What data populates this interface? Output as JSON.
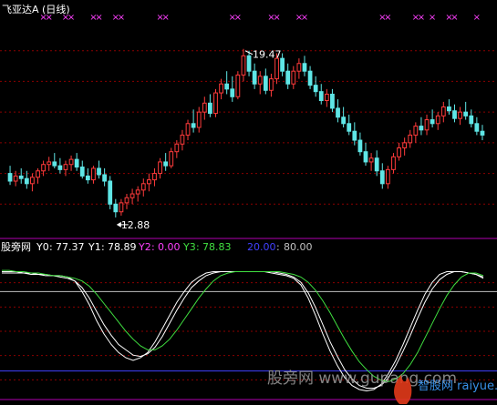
{
  "chart_data": [
    {
      "type": "candlestick",
      "title": "飞亚达A (日线)",
      "colors": {
        "up": "#ff3b3b",
        "down": "#5fe6e6",
        "signal": "#ff40ff",
        "annotation": "#ffffff",
        "grid": "#8b0000"
      },
      "annotations": {
        "high_label": "19.47",
        "low_label": "12.88"
      },
      "signal_marker": "×",
      "signal_index": [
        6,
        7,
        10,
        11,
        15,
        16,
        19,
        20,
        27,
        28,
        40,
        41,
        47,
        48,
        52,
        53,
        67,
        68,
        73,
        74,
        76,
        79,
        80,
        84
      ],
      "ylim": [
        12.2,
        20.6
      ],
      "candles": [
        [
          14.6,
          14.9,
          14.15,
          14.3
        ],
        [
          14.3,
          14.7,
          14.1,
          14.5
        ],
        [
          14.5,
          14.8,
          14.2,
          14.4
        ],
        [
          14.4,
          14.7,
          14.0,
          14.2
        ],
        [
          14.2,
          14.6,
          13.9,
          14.45
        ],
        [
          14.45,
          14.8,
          14.2,
          14.7
        ],
        [
          14.7,
          15.1,
          14.5,
          14.95
        ],
        [
          14.95,
          15.25,
          14.7,
          15.05
        ],
        [
          15.05,
          15.4,
          14.8,
          14.9
        ],
        [
          14.9,
          15.2,
          14.6,
          14.75
        ],
        [
          14.75,
          15.1,
          14.5,
          14.95
        ],
        [
          14.95,
          15.3,
          14.7,
          15.15
        ],
        [
          15.15,
          15.4,
          14.7,
          14.85
        ],
        [
          14.85,
          15.1,
          14.4,
          14.5
        ],
        [
          14.5,
          14.8,
          14.2,
          14.35
        ],
        [
          14.35,
          14.9,
          14.2,
          14.8
        ],
        [
          14.8,
          15.1,
          14.4,
          14.55
        ],
        [
          14.55,
          14.8,
          14.1,
          14.3
        ],
        [
          14.3,
          14.5,
          13.2,
          13.4
        ],
        [
          13.4,
          13.6,
          12.88,
          13.1
        ],
        [
          13.1,
          13.6,
          12.95,
          13.45
        ],
        [
          13.45,
          13.8,
          13.2,
          13.65
        ],
        [
          13.65,
          14.0,
          13.4,
          13.8
        ],
        [
          13.8,
          14.1,
          13.5,
          13.95
        ],
        [
          13.95,
          14.4,
          13.7,
          14.2
        ],
        [
          14.2,
          14.6,
          13.9,
          14.35
        ],
        [
          14.35,
          14.8,
          14.1,
          14.6
        ],
        [
          14.6,
          15.2,
          14.4,
          15.05
        ],
        [
          15.05,
          15.4,
          14.7,
          14.9
        ],
        [
          14.9,
          15.6,
          14.8,
          15.45
        ],
        [
          15.45,
          15.9,
          15.2,
          15.75
        ],
        [
          15.75,
          16.3,
          15.5,
          16.1
        ],
        [
          16.1,
          16.7,
          15.9,
          16.55
        ],
        [
          16.55,
          17.1,
          16.2,
          16.4
        ],
        [
          16.4,
          17.2,
          16.2,
          17.0
        ],
        [
          17.0,
          17.6,
          16.7,
          17.35
        ],
        [
          17.35,
          17.7,
          16.8,
          16.95
        ],
        [
          16.95,
          17.9,
          16.8,
          17.75
        ],
        [
          17.75,
          18.3,
          17.5,
          18.1
        ],
        [
          18.1,
          18.6,
          17.7,
          17.9
        ],
        [
          17.9,
          18.4,
          17.4,
          17.6
        ],
        [
          17.6,
          18.6,
          17.5,
          18.45
        ],
        [
          18.45,
          19.47,
          18.2,
          19.2
        ],
        [
          19.2,
          19.4,
          18.4,
          18.6
        ],
        [
          18.6,
          18.9,
          17.9,
          18.1
        ],
        [
          18.1,
          18.6,
          17.7,
          18.4
        ],
        [
          18.4,
          18.7,
          17.7,
          17.85
        ],
        [
          17.85,
          18.5,
          17.6,
          18.3
        ],
        [
          18.3,
          19.3,
          18.1,
          19.1
        ],
        [
          19.1,
          19.3,
          18.4,
          18.6
        ],
        [
          18.6,
          18.9,
          17.9,
          18.1
        ],
        [
          18.1,
          18.8,
          17.9,
          18.6
        ],
        [
          18.6,
          19.1,
          18.3,
          18.9
        ],
        [
          18.9,
          19.2,
          18.4,
          18.6
        ],
        [
          18.6,
          18.8,
          17.9,
          18.05
        ],
        [
          18.05,
          18.4,
          17.6,
          17.8
        ],
        [
          17.8,
          18.1,
          17.3,
          17.45
        ],
        [
          17.45,
          17.9,
          17.2,
          17.7
        ],
        [
          17.7,
          17.9,
          17.0,
          17.15
        ],
        [
          17.15,
          17.5,
          16.6,
          16.8
        ],
        [
          16.8,
          17.2,
          16.4,
          16.55
        ],
        [
          16.55,
          16.9,
          16.1,
          16.25
        ],
        [
          16.25,
          16.6,
          15.7,
          15.9
        ],
        [
          15.9,
          16.2,
          15.3,
          15.45
        ],
        [
          15.45,
          15.8,
          14.9,
          15.05
        ],
        [
          15.05,
          15.4,
          14.7,
          15.2
        ],
        [
          15.2,
          15.5,
          14.5,
          14.7
        ],
        [
          14.7,
          15.0,
          14.0,
          14.2
        ],
        [
          14.2,
          14.9,
          14.0,
          14.75
        ],
        [
          14.75,
          15.4,
          14.6,
          15.25
        ],
        [
          15.25,
          15.8,
          15.1,
          15.6
        ],
        [
          15.6,
          16.0,
          15.3,
          15.8
        ],
        [
          15.8,
          16.3,
          15.6,
          16.1
        ],
        [
          16.1,
          16.6,
          15.8,
          16.45
        ],
        [
          16.45,
          16.8,
          16.1,
          16.3
        ],
        [
          16.3,
          16.9,
          16.1,
          16.7
        ],
        [
          16.7,
          17.1,
          16.4,
          16.55
        ],
        [
          16.55,
          17.0,
          16.3,
          16.85
        ],
        [
          16.85,
          17.4,
          16.6,
          17.2
        ],
        [
          17.2,
          17.5,
          16.9,
          17.05
        ],
        [
          17.05,
          17.3,
          16.6,
          16.75
        ],
        [
          16.75,
          17.2,
          16.5,
          17.0
        ],
        [
          17.0,
          17.4,
          16.7,
          16.85
        ],
        [
          16.85,
          17.1,
          16.4,
          16.55
        ],
        [
          16.55,
          16.8,
          16.1,
          16.25
        ],
        [
          16.25,
          16.5,
          15.9,
          16.1
        ]
      ]
    },
    {
      "type": "line",
      "title": "股旁网",
      "ylim": [
        -5,
        105
      ],
      "series": [
        {
          "name": "Y0",
          "value_label": "77.37",
          "color": "#ffffff",
          "values": [
            95,
            95,
            95,
            94,
            94,
            93,
            93,
            92,
            92,
            91,
            88,
            80,
            70,
            58,
            48,
            40,
            34,
            30,
            28,
            30,
            34,
            42,
            52,
            62,
            72,
            80,
            87,
            91,
            94,
            95,
            95,
            95,
            95,
            95,
            95,
            95,
            95,
            94,
            93,
            92,
            90,
            85,
            75,
            62,
            48,
            35,
            24,
            15,
            9,
            6,
            5,
            6,
            10,
            18,
            28,
            40,
            53,
            66,
            78,
            87,
            93,
            95,
            95,
            95,
            94,
            93,
            90
          ]
        },
        {
          "name": "Y1",
          "value_label": "78.89",
          "color": "#ffffff",
          "values": [
            94,
            94,
            94,
            94,
            93,
            93,
            92,
            92,
            91,
            90,
            88,
            83,
            75,
            65,
            55,
            47,
            40,
            36,
            32,
            31,
            33,
            38,
            46,
            56,
            66,
            75,
            83,
            88,
            92,
            94,
            95,
            95,
            95,
            95,
            95,
            95,
            95,
            95,
            94,
            93,
            91,
            87,
            79,
            68,
            55,
            42,
            31,
            21,
            14,
            9,
            7,
            7,
            9,
            15,
            24,
            35,
            47,
            60,
            72,
            82,
            89,
            93,
            95,
            95,
            94,
            93,
            91
          ]
        },
        {
          "name": "Y2",
          "value_label": "0.00",
          "color": "#ff40ff",
          "values": []
        },
        {
          "name": "Y3",
          "value_label": "78.83",
          "color": "#40e040",
          "values": [
            96,
            96,
            95,
            95,
            94,
            94,
            93,
            92,
            92,
            91,
            90,
            88,
            84,
            78,
            71,
            64,
            57,
            50,
            44,
            39,
            36,
            36,
            39,
            44,
            51,
            59,
            67,
            75,
            82,
            88,
            92,
            94,
            95,
            95,
            95,
            95,
            95,
            95,
            95,
            94,
            93,
            91,
            87,
            81,
            73,
            64,
            54,
            44,
            35,
            27,
            21,
            16,
            13,
            12,
            14,
            18,
            25,
            34,
            45,
            56,
            67,
            77,
            85,
            91,
            94,
            94,
            92
          ]
        }
      ],
      "reference_lines": [
        {
          "label": "20.00",
          "value": 20,
          "color": "#4040ff"
        },
        {
          "label": "80.00",
          "value": 80,
          "color": "#c0c0c0"
        }
      ],
      "watermarks": [
        "股旁网 www.gupang.com",
        "智股网 raiyue.com"
      ]
    }
  ]
}
